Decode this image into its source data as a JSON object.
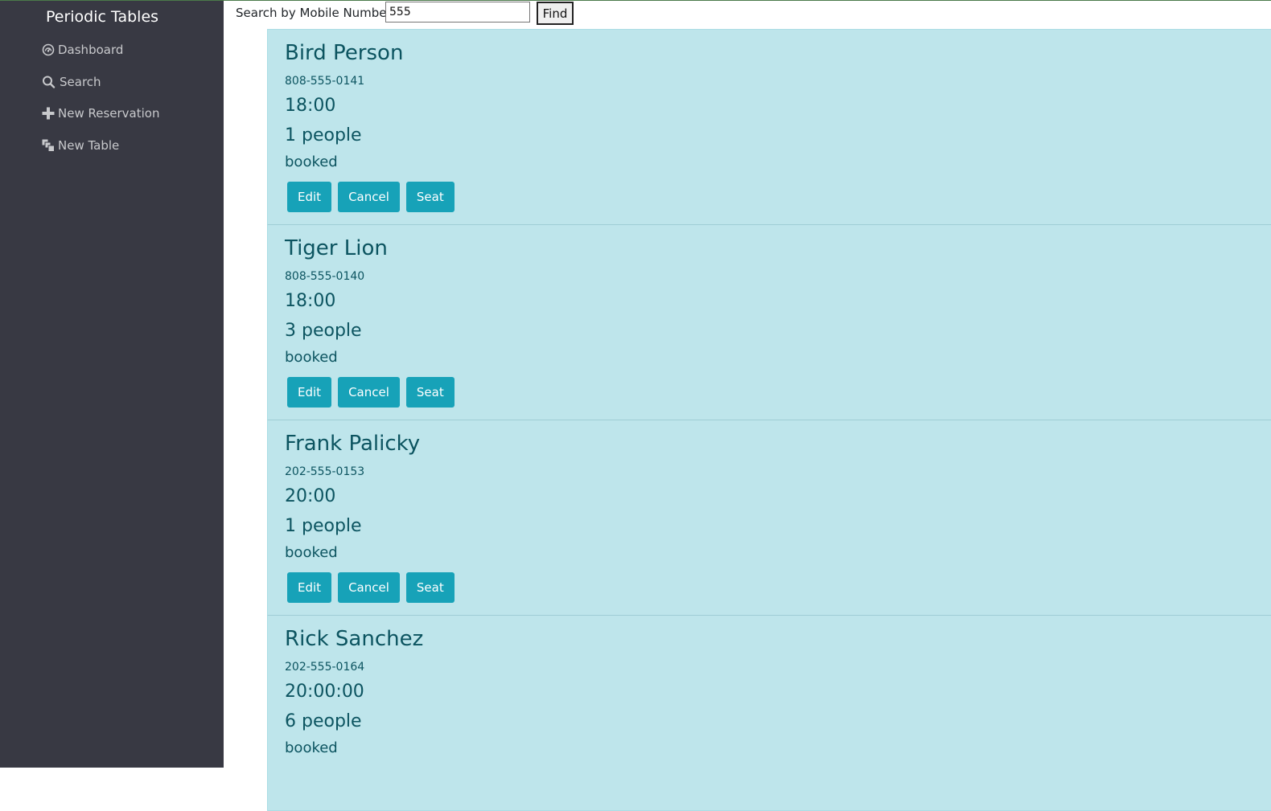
{
  "app": {
    "brand": "Periodic Tables"
  },
  "sidebar": {
    "items": [
      {
        "label": "Dashboard",
        "icon": "dashboard-icon"
      },
      {
        "label": "Search",
        "icon": "search-icon"
      },
      {
        "label": "New Reservation",
        "icon": "plus-icon"
      },
      {
        "label": "New Table",
        "icon": "table-icon"
      }
    ]
  },
  "search": {
    "label": "Search by Mobile Number:",
    "value": "555",
    "button": "Find"
  },
  "colors": {
    "sidebar_bg": "#383943",
    "card_bg": "#bee5eb",
    "card_text": "#0c5460",
    "button_bg": "#17a2b8"
  },
  "reservations": [
    {
      "name": "Bird Person",
      "phone": "808-555-0141",
      "time": "18:00",
      "people": "1 people",
      "status": "booked",
      "actions": [
        "Edit",
        "Cancel",
        "Seat"
      ]
    },
    {
      "name": "Tiger Lion",
      "phone": "808-555-0140",
      "time": "18:00",
      "people": "3 people",
      "status": "booked",
      "actions": [
        "Edit",
        "Cancel",
        "Seat"
      ]
    },
    {
      "name": "Frank Palicky",
      "phone": "202-555-0153",
      "time": "20:00",
      "people": "1 people",
      "status": "booked",
      "actions": [
        "Edit",
        "Cancel",
        "Seat"
      ]
    },
    {
      "name": "Rick Sanchez",
      "phone": "202-555-0164",
      "time": "20:00:00",
      "people": "6 people",
      "status": "booked",
      "actions": []
    }
  ]
}
